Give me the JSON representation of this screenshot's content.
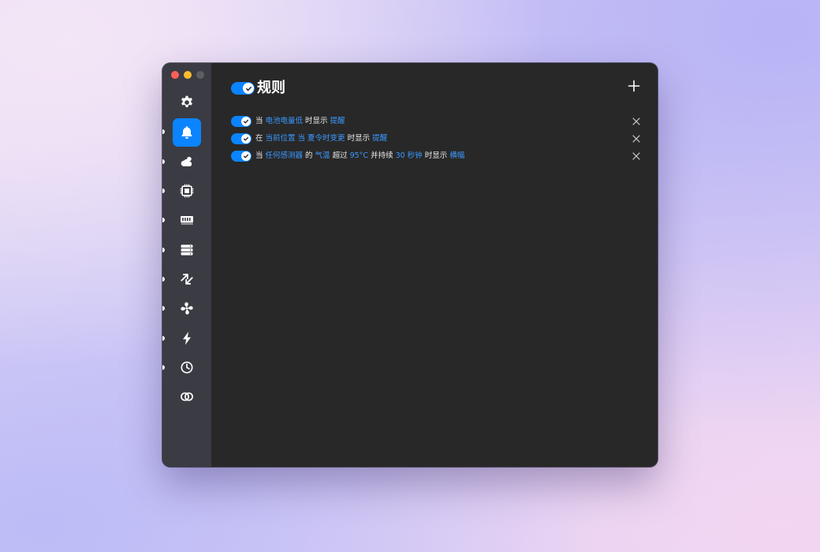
{
  "window": {
    "traffic_lights": [
      "close",
      "minimize",
      "zoom"
    ]
  },
  "sidebar": {
    "items": [
      {
        "name": "settings",
        "icon": "gear-icon"
      },
      {
        "name": "notifications",
        "icon": "bell-icon",
        "active": true
      },
      {
        "name": "weather",
        "icon": "cloud-sun-icon"
      },
      {
        "name": "cpu",
        "icon": "cpu-chip-icon"
      },
      {
        "name": "memory",
        "icon": "memory-icon"
      },
      {
        "name": "disk",
        "icon": "disk-stack-icon"
      },
      {
        "name": "network",
        "icon": "arrows-icon"
      },
      {
        "name": "fan",
        "icon": "fan-icon"
      },
      {
        "name": "power",
        "icon": "bolt-icon"
      },
      {
        "name": "clock",
        "icon": "clock-icon"
      },
      {
        "name": "combined",
        "icon": "rings-icon"
      }
    ]
  },
  "main": {
    "title": "规则",
    "rules": [
      {
        "enabled": true,
        "parts": [
          {
            "text": "当",
            "link": false
          },
          {
            "text": "电池电量低",
            "link": true
          },
          {
            "text": "时显示",
            "link": false
          },
          {
            "text": "提醒",
            "link": true
          }
        ]
      },
      {
        "enabled": true,
        "parts": [
          {
            "text": "在",
            "link": false
          },
          {
            "text": "当前位置",
            "link": true
          },
          {
            "text": "当",
            "link": true
          },
          {
            "text": "夏令时变更",
            "link": true
          },
          {
            "text": "时显示",
            "link": false
          },
          {
            "text": "提醒",
            "link": true
          }
        ]
      },
      {
        "enabled": true,
        "parts": [
          {
            "text": "当",
            "link": false
          },
          {
            "text": "任何感测器",
            "link": true
          },
          {
            "text": "的",
            "link": false
          },
          {
            "text": "气温",
            "link": true
          },
          {
            "text": "超过",
            "link": false
          },
          {
            "text": "95°C",
            "link": true
          },
          {
            "text": "并持续",
            "link": false
          },
          {
            "text": "30 秒钟",
            "link": true
          },
          {
            "text": "时显示",
            "link": false
          },
          {
            "text": "横幅",
            "link": true
          }
        ]
      }
    ]
  },
  "colors": {
    "accent": "#0a84ff",
    "link": "#3b98ff",
    "window_bg": "#282828",
    "sidebar_bg": "#3b3b43"
  }
}
